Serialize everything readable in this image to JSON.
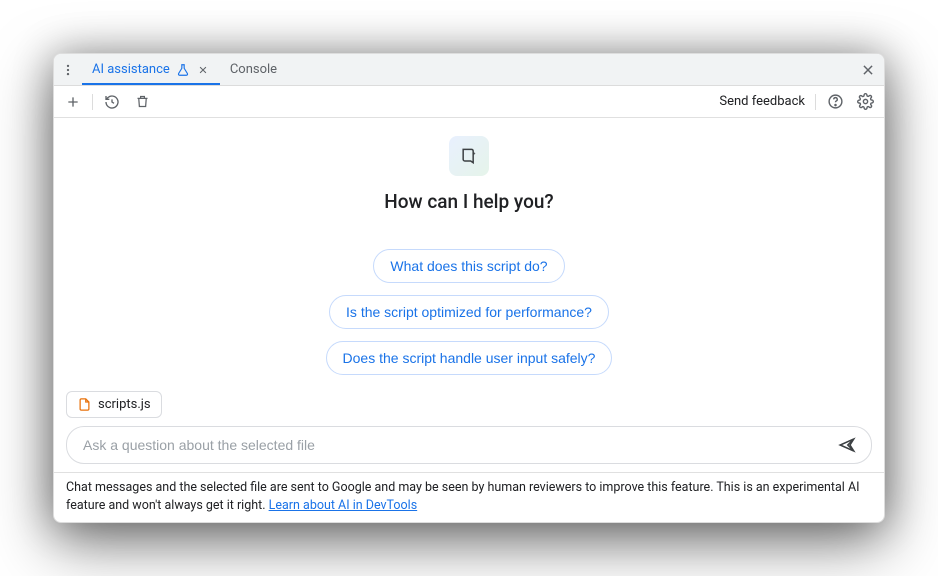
{
  "tabs": {
    "active": {
      "label": "AI assistance"
    },
    "secondary": {
      "label": "Console"
    }
  },
  "toolbar": {
    "feedback": "Send feedback"
  },
  "hero": {
    "title": "How can I help you?"
  },
  "suggestions": [
    "What does this script do?",
    "Is the script optimized for performance?",
    "Does the script handle user input safely?"
  ],
  "context": {
    "file": "scripts.js"
  },
  "input": {
    "placeholder": "Ask a question about the selected file"
  },
  "disclaimer": {
    "text_before": "Chat messages and the selected file are sent to Google and may be seen by human reviewers to improve this feature. This is an experimental AI feature and won't always get it right. ",
    "link": "Learn about AI in DevTools"
  }
}
